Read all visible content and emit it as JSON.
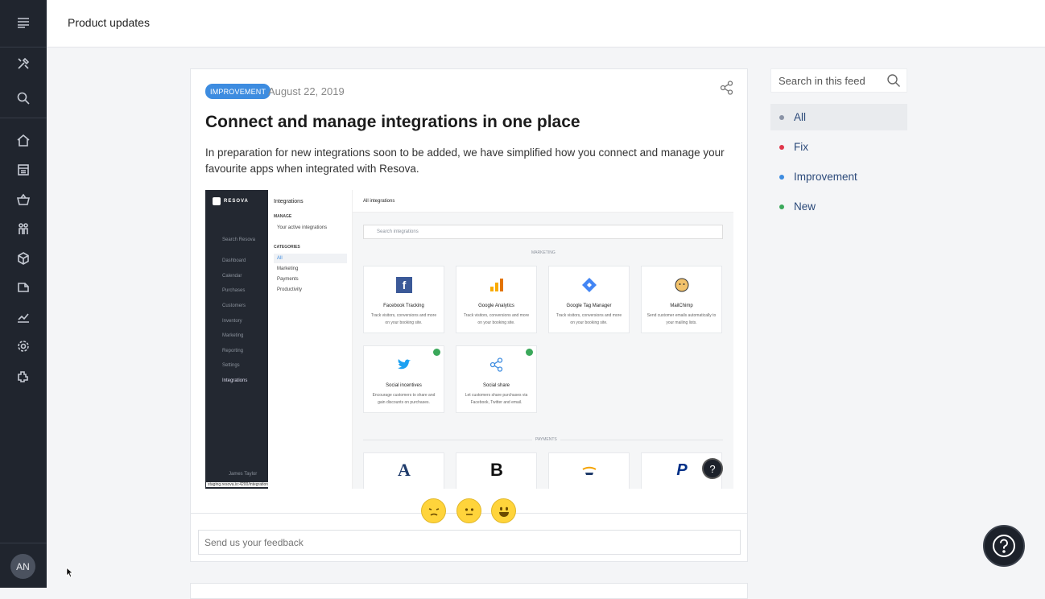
{
  "header": {
    "title": "Product updates"
  },
  "rail": {
    "icons": [
      "menu-icon",
      "tools-icon",
      "search-icon",
      "home-icon",
      "calendar-icon",
      "basket-icon",
      "customers-icon",
      "inventory-icon",
      "marketing-icon",
      "reporting-icon",
      "settings-icon",
      "integrations-icon"
    ],
    "avatar_initials": "AN"
  },
  "post": {
    "badge": "IMPROVEMENT",
    "date": "August 22, 2019",
    "title": "Connect and manage integrations in one place",
    "description": "In preparation for new integrations soon to be added, we have simplified how you connect and manage your favourite apps when integrated with Resova.",
    "screenshot": {
      "brand": "RESOVA",
      "search_label": "Search Resova",
      "side_items": [
        "Dashboard",
        "Calendar",
        "Purchases",
        "Customers",
        "Inventory",
        "Marketing",
        "Reporting",
        "Settings",
        "Integrations"
      ],
      "user_name": "James Taylor",
      "url": "staging.resova.io:4200/integrations/manage",
      "nav_title": "Integrations",
      "nav_manage": "MANAGE",
      "nav_active": "Your active integrations",
      "nav_categories": "CATEGORIES",
      "nav_items": [
        "All",
        "Marketing",
        "Payments",
        "Productivity"
      ],
      "main_title": "All integrations",
      "search_placeholder": "Search integrations",
      "section_marketing": "MARKETING",
      "section_payments": "PAYMENTS",
      "tiles": [
        {
          "name": "Facebook Tracking",
          "desc": "Track visitors, conversions and more on your booking site."
        },
        {
          "name": "Google Analytics",
          "desc": "Track visitors, conversions and more on your booking site."
        },
        {
          "name": "Google Tag Manager",
          "desc": "Track visitors, conversions and more on your booking site."
        },
        {
          "name": "MailChimp",
          "desc": "Send customer emails automatically to your mailing lists."
        },
        {
          "name": "Social incentives",
          "desc": "Encourage customers to share and gain discounts on purchases."
        },
        {
          "name": "Social share",
          "desc": "Let customers share purchases via Facebook, Twitter and email."
        }
      ],
      "payment_letters": [
        "A",
        "B"
      ]
    },
    "feedback_placeholder": "Send us your feedback"
  },
  "sidebar": {
    "search_placeholder": "Search in this feed",
    "filters": [
      {
        "label": "All",
        "color": "#8a93a6"
      },
      {
        "label": "Fix",
        "color": "#e0364a"
      },
      {
        "label": "Improvement",
        "color": "#3d8ce0"
      },
      {
        "label": "New",
        "color": "#3aa85a"
      }
    ]
  },
  "colors": {
    "badge": "#3d8ce0",
    "rail": "#20252e",
    "link": "#2c4a7a"
  }
}
